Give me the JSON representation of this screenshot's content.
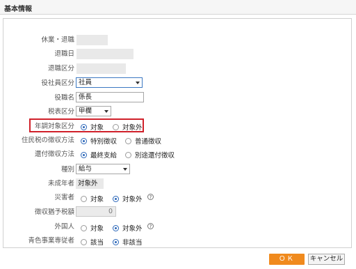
{
  "header": {
    "title": "基本情報"
  },
  "form": {
    "leave_label": "休業・退職",
    "retire_date_label": "退職日",
    "retire_type_label": "退職区分",
    "officer_type_label": "役社員区分",
    "officer_type_value": "社員",
    "title_label": "役職名",
    "title_value": "係長",
    "tax_type_label": "税表区分",
    "tax_type_value": "甲欄",
    "year_end_label": "年調対象区分",
    "year_end_options": [
      "対象",
      "対象外"
    ],
    "resident_tax_label": "住民税の徴収方法",
    "resident_tax_options": [
      "特別徴収",
      "普通徴収"
    ],
    "refund_label": "還付徴収方法",
    "refund_options": [
      "最終支給",
      "別途還付徴収"
    ],
    "type_label": "種別",
    "type_value": "給与",
    "minor_label": "未成年者",
    "minor_value": "対象外",
    "disabled_label": "災害者",
    "disabled_options": [
      "対象",
      "対象外"
    ],
    "withholding_label": "徴収猶予税額",
    "withholding_value": "0",
    "foreigner_label": "外国人",
    "foreigner_options": [
      "対象",
      "対象外"
    ],
    "blue_label": "青色事業専従者",
    "blue_options": [
      "該当",
      "非該当"
    ],
    "help_symbol": "?"
  },
  "footer": {
    "ok_label": "ＯＫ",
    "cancel_label": "キャンセル"
  },
  "colors": {
    "accent": "#f08a1d",
    "highlight": "#d0202a",
    "radio": "#2a66b8"
  }
}
